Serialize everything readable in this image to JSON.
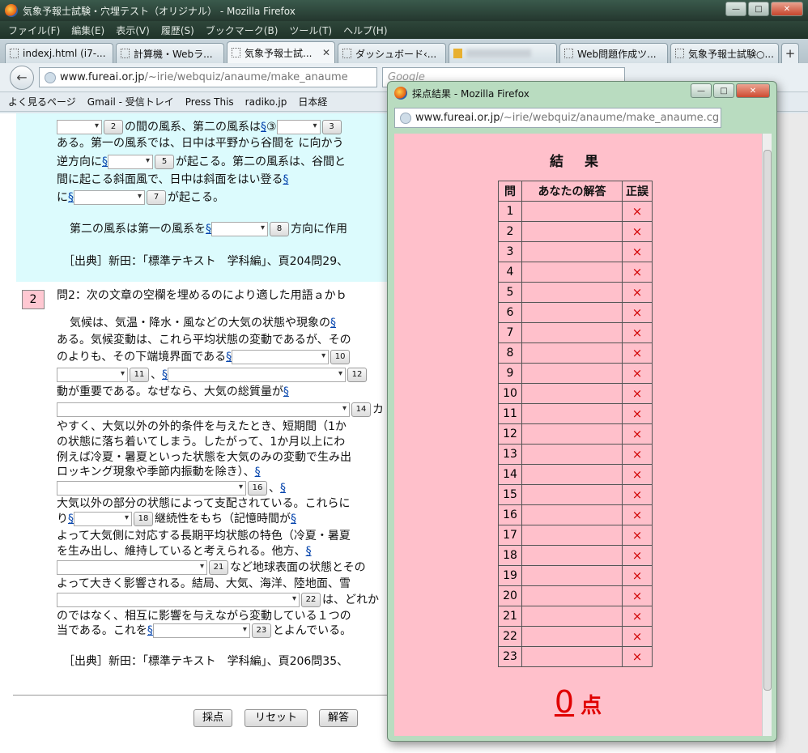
{
  "main_window": {
    "title": "気象予報士試験・穴埋テスト（オリジナル） - Mozilla Firefox",
    "menu": [
      "ファイル(F)",
      "編集(E)",
      "表示(V)",
      "履歴(S)",
      "ブックマーク(B)",
      "ツール(T)",
      "ヘルプ(H)"
    ],
    "tabs": [
      "indexj.html (i7-...",
      "計算機・Webラ...",
      "気象予報士試...",
      "ダッシュボード‹...",
      "",
      "Web問題作成ツ...",
      "気象予報士試験○..."
    ],
    "url_host": "www.fureai.or.jp",
    "url_path": "/~irie/webquiz/anaume/make_anaume",
    "search_placeholder": "Google",
    "bookmarks": [
      "よく見るページ",
      "Gmail - 受信トレイ",
      "Press This",
      "radiko.jp",
      "日本経"
    ]
  },
  "q1": {
    "l1a": "の間の風系、第二の風系は",
    "l1b": "③",
    "l2": "ある。第一の風系では、日中は平野から谷間を に向かう",
    "l3a": "逆方向に",
    "l3b": "が起こる。第二の風系は、谷間と",
    "l4": "間に起こる斜面風で、日中は斜面をはい登る",
    "l5a": "に",
    "l5b": "が起こる。",
    "l6a": "第二の風系は第一の風系を",
    "l6b": "方向に作用",
    "src": "［出典］新田：「標準テキスト　学科編」、頁204問29、"
  },
  "q2": {
    "num": "2",
    "heading": "問2：次の文章の空欄を埋めるのにより適した用語ａかｂ",
    "l1": "気候は、気温・降水・風などの大気の状態や現象の",
    "l2": "ある。気候変動は、これら平均状態の変動であるが、その",
    "l3": "のよりも、その下端境界面である",
    "l4": "、",
    "l5": "動が重要である。なぜなら、大気の総質量が",
    "l6": "カ",
    "l7": "やすく、大気以外の外的条件を与えたとき、短期間（1か",
    "l8": "の状態に落ち着いてしまう。したがって、1か月以上にわ",
    "l9": "例えば冷夏・暑夏といった状態を大気のみの変動で生み出",
    "l10": "ロッキング現象や季節内振動を除き）、",
    "l11": "、",
    "l12": "大気以外の部分の状態によって支配されている。これらに",
    "l13a": "り",
    "l13b": "継続性をもち（記憶時間が",
    "l14": "よって大気側に対応する長期平均状態の特色（冷夏・暑夏",
    "l15": "を生み出し、維持していると考えられる。他方、",
    "l16": "など地球表面の状態とその",
    "l17": "よって大きく影響される。結局、大気、海洋、陸地面、雪",
    "l18": "は、どれか",
    "l19": "のではなく、相互に影響を与えながら変動している１つの",
    "l20a": "当である。これを",
    "l20b": "とよんでいる。",
    "src": "［出典］新田：「標準テキスト　学科編」、頁206問35、"
  },
  "buttons": {
    "grade": "採点",
    "reset": "リセット",
    "answer": "解答"
  },
  "link_mark": "§",
  "blank_numbers": [
    "2",
    "3",
    "5",
    "7",
    "8",
    "10",
    "11",
    "12",
    "14",
    "16",
    "18",
    "21",
    "22",
    "23"
  ],
  "popup": {
    "title": "採点結果 - Mozilla Firefox",
    "url_host": "www.fureai.or.jp",
    "url_path": "/~irie/webquiz/anaume/make_anaume.cg",
    "heading": "結 果",
    "col_q": "問",
    "col_ans": "あなたの解答",
    "col_mark": "正誤",
    "rows": [
      "1",
      "2",
      "3",
      "4",
      "5",
      "6",
      "7",
      "8",
      "9",
      "10",
      "11",
      "12",
      "13",
      "14",
      "15",
      "16",
      "17",
      "18",
      "19",
      "20",
      "21",
      "22",
      "23"
    ],
    "mark": "×",
    "score": "0",
    "score_unit": "点"
  }
}
